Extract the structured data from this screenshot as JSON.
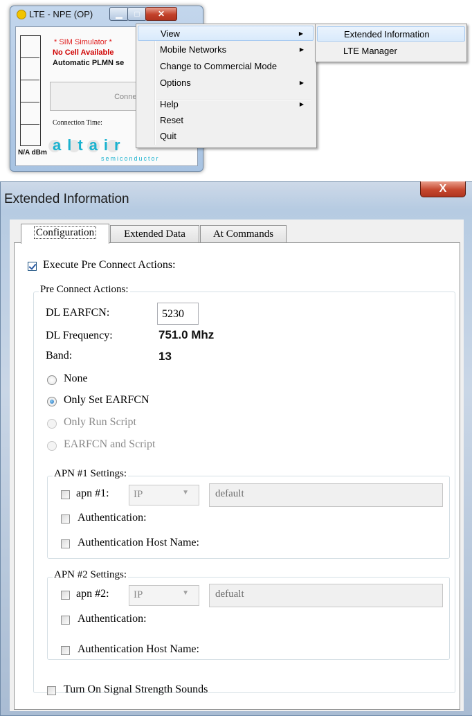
{
  "lte_window": {
    "title": "LTE - NPE (OP)",
    "sim_status": "* SIM Simulator *",
    "cell_status": "No Cell Available",
    "plmn_status": "Automatic PLMN se",
    "connect_label": "Connec",
    "connection_time_label": "Connection Time:",
    "dbm_label": "N/A dBm",
    "logo_text": "altair",
    "logo_sub": "semiconductor"
  },
  "context_menu": {
    "items": [
      {
        "label": "View",
        "has_submenu": true
      },
      {
        "label": "Mobile Networks",
        "has_submenu": true
      },
      {
        "label": "Change to Commercial Mode",
        "has_submenu": false
      },
      {
        "label": "Options",
        "has_submenu": true
      },
      {
        "label": "Help",
        "has_submenu": true
      },
      {
        "label": "Reset",
        "has_submenu": false
      },
      {
        "label": "Quit",
        "has_submenu": false
      }
    ],
    "submenu_arrow": "▶",
    "view_submenu": [
      {
        "label": "Extended Information"
      },
      {
        "label": "LTE Manager"
      }
    ]
  },
  "ext_window": {
    "title": "Extended Information",
    "close_glyph": "X",
    "tabs": [
      {
        "label": "Configuration",
        "active": true
      },
      {
        "label": "Extended Data",
        "active": false
      },
      {
        "label": "At Commands",
        "active": false
      }
    ],
    "execute_pre_connect": {
      "label": "Execute Pre Connect Actions:",
      "checked": true
    },
    "pre_connect_group_title": "Pre Connect Actions:",
    "dl_earfcn": {
      "label": "DL EARFCN:",
      "value": "5230"
    },
    "dl_frequency": {
      "label": "DL Frequency:",
      "value": "751.0 Mhz"
    },
    "band": {
      "label": "Band:",
      "value": "13"
    },
    "radio_options": [
      {
        "label": "None",
        "checked": false,
        "enabled": true
      },
      {
        "label": "Only Set EARFCN",
        "checked": true,
        "enabled": true
      },
      {
        "label": "Only Run Script",
        "checked": false,
        "enabled": false
      },
      {
        "label": "EARFCN and Script",
        "checked": false,
        "enabled": false
      }
    ],
    "apn1": {
      "group_title": "APN #1 Settings:",
      "apn_label": "apn #1:",
      "pdp_type": "IP",
      "apn_value": "default",
      "auth_label": "Authentication:",
      "auth_host_label": "Authentication Host Name:"
    },
    "apn2": {
      "group_title": "APN #2 Settings:",
      "apn_label": "apn #2:",
      "pdp_type": "IP",
      "apn_value": "defualt",
      "auth_label": "Authentication:",
      "auth_host_label": "Authentication Host Name:"
    },
    "signal_sounds": {
      "label": "Turn On Signal Strength Sounds",
      "checked": false
    }
  }
}
